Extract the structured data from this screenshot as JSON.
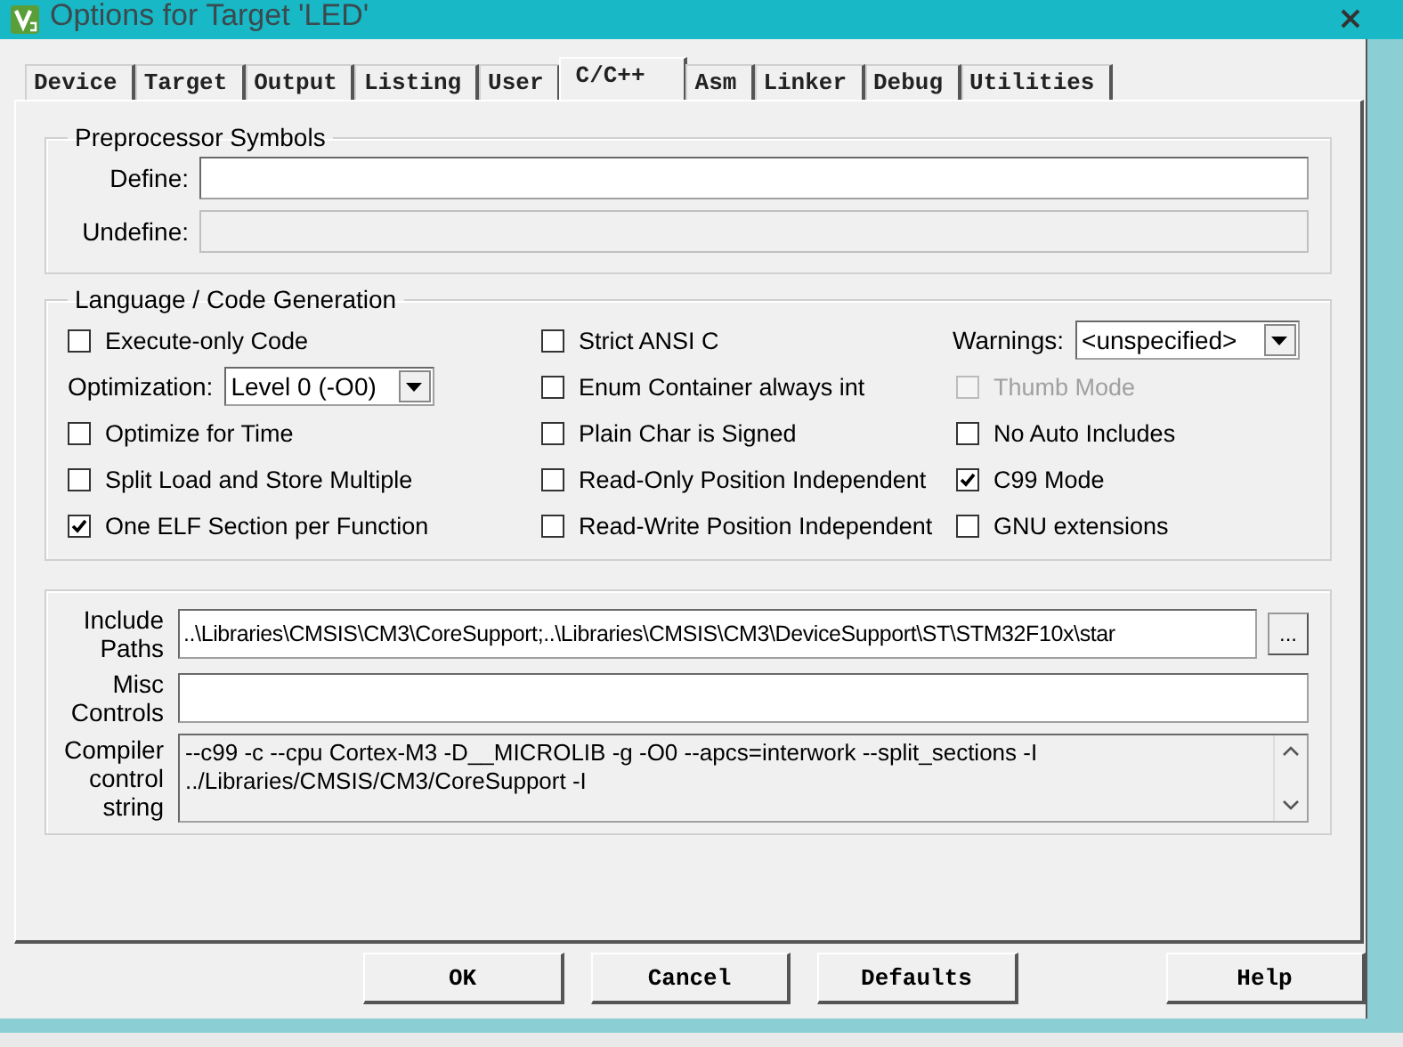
{
  "window": {
    "title": "Options for Target 'LED'"
  },
  "tabs": [
    {
      "label": "Device",
      "selected": false
    },
    {
      "label": "Target",
      "selected": false
    },
    {
      "label": "Output",
      "selected": false
    },
    {
      "label": "Listing",
      "selected": false
    },
    {
      "label": "User",
      "selected": false
    },
    {
      "label": "C/C++",
      "selected": true
    },
    {
      "label": "Asm",
      "selected": false
    },
    {
      "label": "Linker",
      "selected": false
    },
    {
      "label": "Debug",
      "selected": false
    },
    {
      "label": "Utilities",
      "selected": false
    }
  ],
  "preprocessor": {
    "title": "Preprocessor Symbols",
    "fields": [
      {
        "label": "Define:",
        "disabled": false
      },
      {
        "label": "Undefine:",
        "disabled": true
      }
    ]
  },
  "language": {
    "title": "Language / Code Generation",
    "columns": [
      [
        {
          "kind": "checkbox",
          "label": "Execute-only Code",
          "checked": false,
          "disabled": false
        },
        {
          "kind": "select",
          "label": "Optimization:",
          "value": "Level 0 (-O0)"
        },
        {
          "kind": "checkbox",
          "label": "Optimize for Time",
          "checked": false,
          "disabled": false
        },
        {
          "kind": "checkbox",
          "label": "Split Load and Store Multiple",
          "checked": false,
          "disabled": false
        },
        {
          "kind": "checkbox",
          "label": "One ELF Section per Function",
          "checked": true,
          "disabled": false
        }
      ],
      [
        {
          "kind": "checkbox",
          "label": "Strict ANSI C",
          "checked": false,
          "disabled": false
        },
        {
          "kind": "checkbox",
          "label": "Enum Container always int",
          "checked": false,
          "disabled": false
        },
        {
          "kind": "checkbox",
          "label": "Plain Char is Signed",
          "checked": false,
          "disabled": false
        },
        {
          "kind": "checkbox",
          "label": "Read-Only Position Independent",
          "checked": false,
          "disabled": false
        },
        {
          "kind": "checkbox",
          "label": "Read-Write Position Independent",
          "checked": false,
          "disabled": false
        }
      ],
      [
        {
          "kind": "select",
          "label": "Warnings:",
          "value": "<unspecified>"
        },
        {
          "kind": "checkbox",
          "label": "Thumb Mode",
          "checked": false,
          "disabled": true
        },
        {
          "kind": "checkbox",
          "label": "No Auto Includes",
          "checked": false,
          "disabled": false
        },
        {
          "kind": "checkbox",
          "label": "C99 Mode",
          "checked": true,
          "disabled": false
        },
        {
          "kind": "checkbox",
          "label": "GNU extensions",
          "checked": false,
          "disabled": false
        }
      ]
    ]
  },
  "options": [
    {
      "kind": "line",
      "label": "Include Paths",
      "value": "..\\Libraries\\CMSIS\\CM3\\CoreSupport;..\\Libraries\\CMSIS\\CM3\\DeviceSupport\\ST\\STM32F10x\\star",
      "browse": "..."
    },
    {
      "kind": "line",
      "label": "Misc Controls"
    },
    {
      "kind": "multiline",
      "label": "Compiler control string",
      "value": "--c99 -c --cpu Cortex-M3 -D__MICROLIB -g -O0 --apcs=interwork --split_sections -I ../Libraries/CMSIS/CM3/CoreSupport -I"
    }
  ],
  "buttons": [
    {
      "label": "OK"
    },
    {
      "label": "Cancel"
    },
    {
      "label": "Defaults"
    },
    {
      "label": "Help"
    }
  ]
}
